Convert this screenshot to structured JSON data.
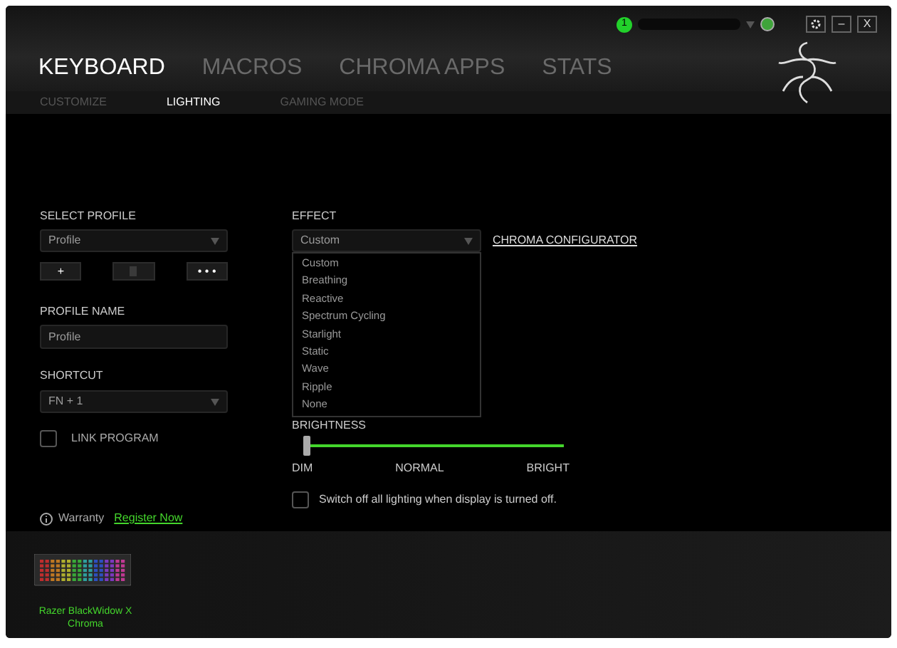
{
  "top_bar": {
    "notification_count": "1",
    "window_buttons": [
      {
        "kind": "settings"
      },
      {
        "kind": "minimize",
        "label": "–"
      },
      {
        "kind": "close",
        "label": "X"
      }
    ]
  },
  "tabs": [
    {
      "label": "KEYBOARD",
      "selected": true
    },
    {
      "label": "MACROS",
      "selected": false
    },
    {
      "label": "CHROMA APPS",
      "selected": false
    },
    {
      "label": "STATS",
      "selected": false
    }
  ],
  "subtabs": [
    {
      "label": "CUSTOMIZE",
      "selected": false
    },
    {
      "label": "LIGHTING",
      "selected": true
    },
    {
      "label": "GAMING MODE",
      "selected": false
    }
  ],
  "profile": {
    "label": "SELECT PROFILE",
    "value": "Profile",
    "buttons": [
      {
        "kind": "add",
        "label": "+"
      },
      {
        "kind": "delete"
      },
      {
        "kind": "more",
        "label": "• • •"
      }
    ],
    "name_label": "PROFILE NAME",
    "name_value": "Profile",
    "shortcut_label": "SHORTCUT",
    "shortcut_value": "FN + 1",
    "link_program": {
      "label": "LINK PROGRAM",
      "checked": false
    }
  },
  "warranty": {
    "label": "Warranty",
    "link": "Register Now"
  },
  "effect": {
    "label": "EFFECT",
    "value": "Custom",
    "expanded": true,
    "link": "CHROMA CONFIGURATOR",
    "options": [
      "Custom",
      "Breathing",
      "Reactive",
      "Spectrum Cycling",
      "Starlight",
      "Static",
      "Wave",
      "Ripple",
      "None"
    ]
  },
  "brightness": {
    "label": "BRIGHTNESS",
    "level": 0,
    "ticks": [
      "DIM",
      "NORMAL",
      "BRIGHT"
    ]
  },
  "display_off": {
    "label": "Switch off all lighting when display is turned off.",
    "checked": false
  },
  "device": {
    "name": "Razer BlackWidow X Chroma"
  }
}
